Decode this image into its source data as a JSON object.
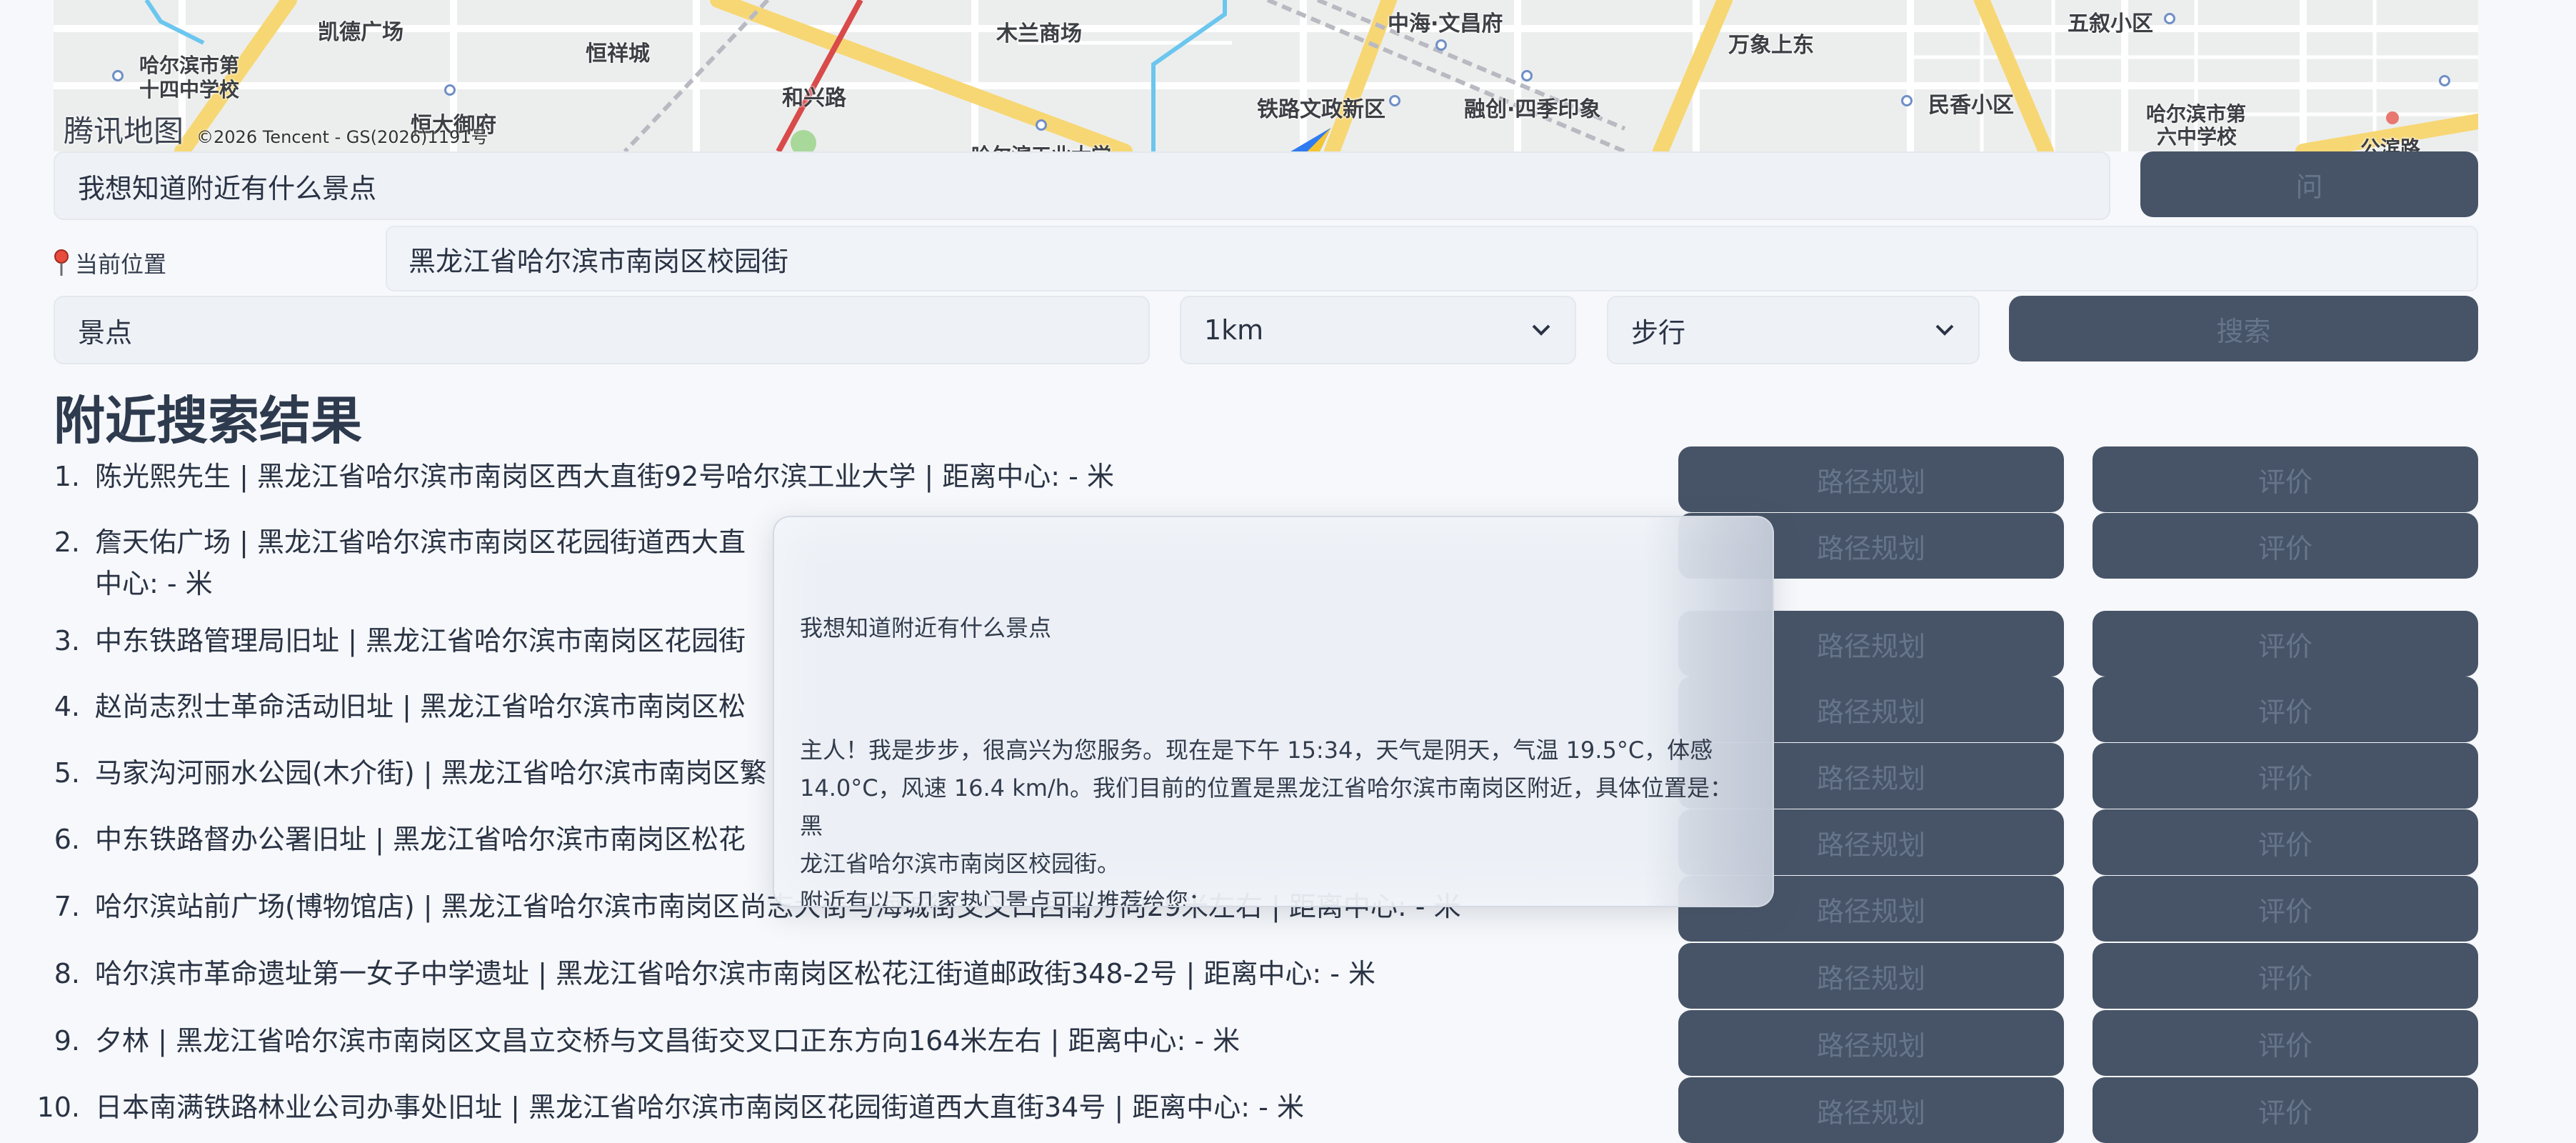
{
  "map": {
    "logo_text": "腾讯地图",
    "copyright": "©2026 Tencent - GS(2026)1191号",
    "labels": [
      "凯德广场",
      "哈尔滨市第",
      "十四中学校",
      "恒祥城",
      "恒大御府",
      "和兴路",
      "木兰商场",
      "中海·文昌府",
      "万象上东",
      "五叙小区",
      "铁路文政新区",
      "融创·四季印象",
      "民香小区",
      "哈尔滨市第",
      "六中学校",
      "公滨路",
      "哈尔滨工业大学"
    ]
  },
  "form": {
    "question_value": "我想知道附近有什么景点",
    "ask_label": "问",
    "location_label": "当前位置",
    "location_value": "黑龙江省哈尔滨市南岗区校园街",
    "keyword_value": "景点",
    "radius_value": "1km",
    "mode_value": "步行",
    "search_label": "搜索"
  },
  "results": {
    "title": "附近搜索结果",
    "route_label": "路径规划",
    "review_label": "评价",
    "items": [
      {
        "num": "1.",
        "text": "陈光熙先生 | 黑龙江省哈尔滨市南岗区西大直街92号哈尔滨工业大学 | 距离中心: - 米"
      },
      {
        "num": "2.",
        "text": "詹天佑广场 | 黑龙江省哈尔滨市南岗区花园街道西大直",
        "text2": "中心: - 米"
      },
      {
        "num": "3.",
        "text": "中东铁路管理局旧址 | 黑龙江省哈尔滨市南岗区花园街"
      },
      {
        "num": "4.",
        "text": "赵尚志烈士革命活动旧址 | 黑龙江省哈尔滨市南岗区松"
      },
      {
        "num": "5.",
        "text": "马家沟河丽水公园(木介街) | 黑龙江省哈尔滨市南岗区繁"
      },
      {
        "num": "6.",
        "text": "中东铁路督办公署旧址 | 黑龙江省哈尔滨市南岗区松花"
      },
      {
        "num": "7.",
        "text": "哈尔滨站前广场(博物馆店) | 黑龙江省哈尔滨市南岗区尚志大街与海城街交叉口西南方向29米左右 | 距离中心: - 米"
      },
      {
        "num": "8.",
        "text": "哈尔滨市革命遗址第一女子中学遗址 | 黑龙江省哈尔滨市南岗区松花江街道邮政街348-2号 | 距离中心: - 米"
      },
      {
        "num": "9.",
        "text": "夕林 | 黑龙江省哈尔滨市南岗区文昌立交桥与文昌街交叉口正东方向164米左右 | 距离中心: - 米"
      },
      {
        "num": "10.",
        "text": "日本南满铁路林业公司办事处旧址 | 黑龙江省哈尔滨市南岗区花园街道西大直街34号 | 距离中心: - 米"
      }
    ]
  },
  "popup": {
    "question": "我想知道附近有什么景点",
    "answer_line1": "主人！我是步步，很高兴为您服务。现在是下午 15:34，天气是阴天，气温 19.5°C，体感",
    "answer_line2": "14.0°C，风速 16.4 km/h。我们目前的位置是黑龙江省哈尔滨市南岗区附近，具体位置是：黑",
    "answer_line3": "龙江省哈尔滨市南岗区校园街。",
    "answer_line4": "附近有以下几家热门景点可以推荐给您："
  },
  "colors": {
    "button_bg": "#475467",
    "button_text": "#66758a",
    "page_bg": "#f6f8fb",
    "map_road_yellow": "#f7d774",
    "map_rail_red": "#d94a4a",
    "map_water": "#6cc6ee"
  }
}
